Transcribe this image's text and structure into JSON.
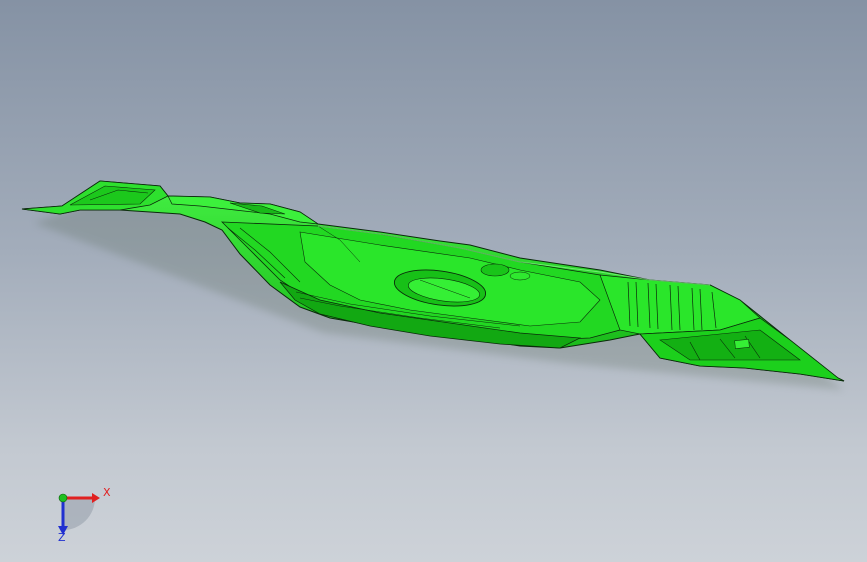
{
  "viewport": {
    "background_top": "#8592a4",
    "background_bottom": "#cdd2d8"
  },
  "model": {
    "part_color": "#1ee81e",
    "edge_color": "#0a2a0a"
  },
  "triad": {
    "x_label": "X",
    "z_label": "Z",
    "x_color": "#e02020",
    "y_color": "#20c020",
    "z_color": "#2030d0"
  }
}
